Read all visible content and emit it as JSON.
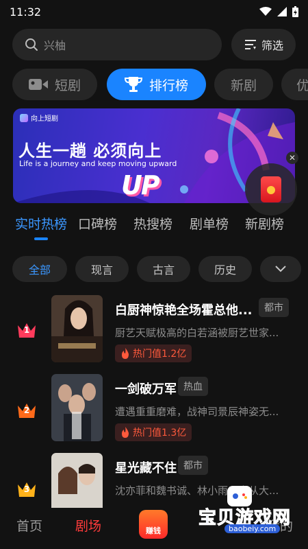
{
  "status_bar": {
    "time": "11:32"
  },
  "search": {
    "placeholder": "兴柚"
  },
  "filter": {
    "label": "筛选"
  },
  "category_tabs": [
    {
      "label": "短剧",
      "icon": "video-camera-icon",
      "active": false
    },
    {
      "label": "排行榜",
      "icon": "trophy-icon",
      "active": true
    },
    {
      "label": "新剧",
      "active": false
    },
    {
      "label": "优",
      "active": false
    }
  ],
  "banner": {
    "brand": "向上短剧",
    "title": "人生一趟  必须向上",
    "subtitle": "Life is a journey and  keep moving upward",
    "graphic_text": "UP"
  },
  "rank_tabs": [
    "实时热榜",
    "口碑榜",
    "热搜榜",
    "剧单榜",
    "新剧榜"
  ],
  "genre_chips": [
    "全部",
    "现言",
    "古言",
    "历史"
  ],
  "list": [
    {
      "rank": "1",
      "title": "白厨神惊艳全场霍总他...",
      "tag": "都市",
      "desc": "厨艺天赋极高的白若涵被厨艺世家...",
      "hot": "热门值1.2亿",
      "crown_color": "#ff3b5c"
    },
    {
      "rank": "2",
      "title": "一剑破万军",
      "tag": "热血",
      "desc": "遭遇重重磨难，战神司景辰神姿无...",
      "hot": "热门值1.3亿",
      "crown_color": "#ff6a1a"
    },
    {
      "rank": "3",
      "title": "星光藏不住",
      "tag": "都市",
      "desc": "沈亦菲和魏书诚、林小雨三人从大...",
      "hot": "",
      "crown_color": "#ffb21a"
    }
  ],
  "bottom_nav": {
    "home": "首页",
    "theater": "剧场",
    "earn": "赚钱",
    "mine": "我的"
  },
  "watermark": {
    "text": "宝贝游戏网",
    "url": "baobeiy.com"
  },
  "colors": {
    "accent": "#1a84ff",
    "nav_active": "#ff3b3b",
    "hot": "#ff5a3c"
  }
}
